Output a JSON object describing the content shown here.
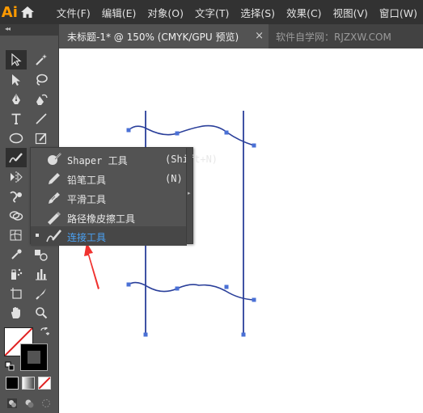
{
  "app": {
    "logo_text": "Ai",
    "brand_color": "#ff9a00"
  },
  "menu": {
    "items": [
      "文件(F)",
      "编辑(E)",
      "对象(O)",
      "文字(T)",
      "选择(S)",
      "效果(C)",
      "视图(V)",
      "窗口(W)"
    ]
  },
  "tabs": {
    "active_title": "未标题-1* @ 150% (CMYK/GPU 预览)",
    "close_glyph": "×",
    "inactive_title": "软件自学网：RJZXW.COM"
  },
  "toolbar": {
    "collapse_glyph": "◂◂"
  },
  "flyout": {
    "tearoff_glyph": "▸",
    "items": [
      {
        "label": "Shaper 工具",
        "shortcut": "(Shift+N)",
        "icon": "shaper-icon"
      },
      {
        "label": "铅笔工具",
        "shortcut": "(N)",
        "icon": "pencil-icon"
      },
      {
        "label": "平滑工具",
        "shortcut": "",
        "icon": "smooth-icon"
      },
      {
        "label": "路径橡皮擦工具",
        "shortcut": "",
        "icon": "path-eraser-icon"
      },
      {
        "label": "连接工具",
        "shortcut": "",
        "icon": "join-icon",
        "selected": true
      }
    ]
  },
  "colors": {
    "path_stroke": "#2a3f9a",
    "anchor": "#4a70d6",
    "annotation_arrow": "#f0322f",
    "selected_text": "#4aa2f5"
  }
}
